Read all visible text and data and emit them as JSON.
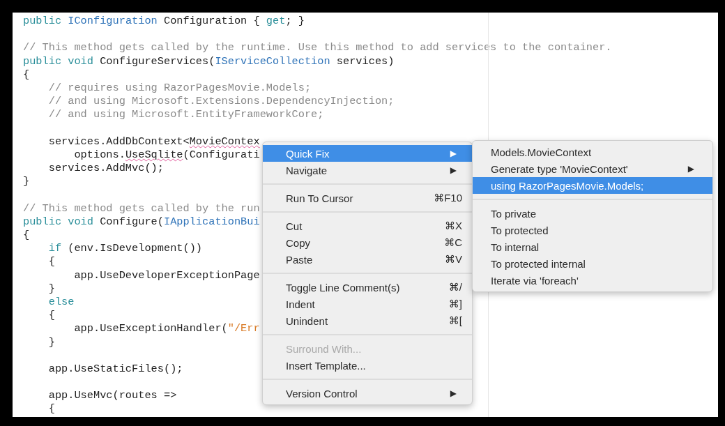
{
  "editor": {
    "lines": [
      {
        "kind": "code",
        "tokens": [
          {
            "text": "public ",
            "kind": "keyword"
          },
          {
            "text": "IConfiguration",
            "kind": "type"
          },
          {
            "text": " Configuration { ",
            "kind": "plain"
          },
          {
            "text": "get",
            "kind": "keyword"
          },
          {
            "text": "; }",
            "kind": "plain"
          }
        ]
      },
      {
        "kind": "blank"
      },
      {
        "kind": "code",
        "tokens": [
          {
            "text": "// This method gets called by the runtime. Use this method to add services to the container.",
            "kind": "comment"
          }
        ]
      },
      {
        "kind": "code",
        "tokens": [
          {
            "text": "public void",
            "kind": "keyword"
          },
          {
            "text": " ConfigureServices(",
            "kind": "plain"
          },
          {
            "text": "IServiceCollection",
            "kind": "type"
          },
          {
            "text": " services)",
            "kind": "plain"
          }
        ]
      },
      {
        "kind": "code",
        "tokens": [
          {
            "text": "{",
            "kind": "plain"
          }
        ]
      },
      {
        "kind": "code",
        "tokens": [
          {
            "text": "    // requires using RazorPagesMovie.Models;",
            "kind": "comment"
          }
        ]
      },
      {
        "kind": "code",
        "tokens": [
          {
            "text": "    // and using Microsoft.Extensions.DependencyInjection;",
            "kind": "comment"
          }
        ]
      },
      {
        "kind": "code",
        "tokens": [
          {
            "text": "    // and using Microsoft.EntityFrameworkCore;",
            "kind": "comment"
          }
        ]
      },
      {
        "kind": "blank"
      },
      {
        "kind": "code",
        "tokens": [
          {
            "text": "    services.AddDbContext<",
            "kind": "plain"
          },
          {
            "text": "MovieContex",
            "kind": "error"
          }
        ]
      },
      {
        "kind": "code",
        "tokens": [
          {
            "text": "        options.",
            "kind": "plain"
          },
          {
            "text": "UseSqlite",
            "kind": "error"
          },
          {
            "text": "(Configurati",
            "kind": "plain"
          }
        ]
      },
      {
        "kind": "code",
        "tokens": [
          {
            "text": "    services.AddMvc();",
            "kind": "plain"
          }
        ]
      },
      {
        "kind": "code",
        "tokens": [
          {
            "text": "}",
            "kind": "plain"
          }
        ]
      },
      {
        "kind": "blank"
      },
      {
        "kind": "code",
        "tokens": [
          {
            "text": "// This method gets called by the run",
            "kind": "comment"
          }
        ]
      },
      {
        "kind": "code",
        "tokens": [
          {
            "text": "public void",
            "kind": "keyword"
          },
          {
            "text": " Configure(",
            "kind": "plain"
          },
          {
            "text": "IApplicationBui",
            "kind": "type"
          }
        ]
      },
      {
        "kind": "code",
        "tokens": [
          {
            "text": "{",
            "kind": "plain"
          }
        ]
      },
      {
        "kind": "code",
        "tokens": [
          {
            "text": "    if",
            "kind": "keyword"
          },
          {
            "text": " (env.IsDevelopment())",
            "kind": "plain"
          }
        ]
      },
      {
        "kind": "code",
        "tokens": [
          {
            "text": "    {",
            "kind": "plain"
          }
        ]
      },
      {
        "kind": "code",
        "tokens": [
          {
            "text": "        app.UseDeveloperExceptionPage",
            "kind": "plain"
          }
        ]
      },
      {
        "kind": "code",
        "tokens": [
          {
            "text": "    }",
            "kind": "plain"
          }
        ]
      },
      {
        "kind": "code",
        "tokens": [
          {
            "text": "    else",
            "kind": "keyword"
          }
        ]
      },
      {
        "kind": "code",
        "tokens": [
          {
            "text": "    {",
            "kind": "plain"
          }
        ]
      },
      {
        "kind": "code",
        "tokens": [
          {
            "text": "        app.UseExceptionHandler(",
            "kind": "plain"
          },
          {
            "text": "\"/Err",
            "kind": "string"
          }
        ]
      },
      {
        "kind": "code",
        "tokens": [
          {
            "text": "    }",
            "kind": "plain"
          }
        ]
      },
      {
        "kind": "blank"
      },
      {
        "kind": "code",
        "tokens": [
          {
            "text": "    app.UseStaticFiles();",
            "kind": "plain"
          }
        ]
      },
      {
        "kind": "blank"
      },
      {
        "kind": "code",
        "tokens": [
          {
            "text": "    app.UseMvc(routes =>",
            "kind": "plain"
          }
        ]
      },
      {
        "kind": "code",
        "tokens": [
          {
            "text": "    {",
            "kind": "plain"
          }
        ]
      }
    ]
  },
  "context_menu": {
    "items": [
      {
        "kind": "item",
        "label": "Quick Fix",
        "arrow": "▶",
        "selected": true,
        "disabled": false
      },
      {
        "kind": "item",
        "label": "Navigate",
        "arrow": "▶",
        "selected": false,
        "disabled": false
      },
      {
        "kind": "separator"
      },
      {
        "kind": "item",
        "label": "Run To Cursor",
        "shortcut": "⌘F10",
        "selected": false,
        "disabled": false
      },
      {
        "kind": "separator"
      },
      {
        "kind": "item",
        "label": "Cut",
        "shortcut": "⌘X",
        "selected": false,
        "disabled": false
      },
      {
        "kind": "item",
        "label": "Copy",
        "shortcut": "⌘C",
        "selected": false,
        "disabled": false
      },
      {
        "kind": "item",
        "label": "Paste",
        "shortcut": "⌘V",
        "selected": false,
        "disabled": false
      },
      {
        "kind": "separator"
      },
      {
        "kind": "item",
        "label": "Toggle Line Comment(s)",
        "shortcut": "⌘/",
        "selected": false,
        "disabled": false
      },
      {
        "kind": "item",
        "label": "Indent",
        "shortcut": "⌘]",
        "selected": false,
        "disabled": false
      },
      {
        "kind": "item",
        "label": "Unindent",
        "shortcut": "⌘[",
        "selected": false,
        "disabled": false
      },
      {
        "kind": "separator"
      },
      {
        "kind": "item",
        "label": "Surround With...",
        "selected": false,
        "disabled": true
      },
      {
        "kind": "item",
        "label": "Insert Template...",
        "selected": false,
        "disabled": false
      },
      {
        "kind": "separator"
      },
      {
        "kind": "item",
        "label": "Version Control",
        "arrow": "▶",
        "selected": false,
        "disabled": false
      }
    ]
  },
  "submenu": {
    "items": [
      {
        "kind": "item",
        "label": "Models.MovieContext",
        "selected": false,
        "disabled": false
      },
      {
        "kind": "item",
        "label": "Generate type 'MovieContext'",
        "arrow": "▶",
        "selected": false,
        "disabled": false
      },
      {
        "kind": "item",
        "label": "using RazorPagesMovie.Models;",
        "selected": true,
        "disabled": false
      },
      {
        "kind": "separator"
      },
      {
        "kind": "item",
        "label": "To private",
        "selected": false,
        "disabled": false
      },
      {
        "kind": "item",
        "label": "To protected",
        "selected": false,
        "disabled": false
      },
      {
        "kind": "item",
        "label": "To internal",
        "selected": false,
        "disabled": false
      },
      {
        "kind": "item",
        "label": "To protected internal",
        "selected": false,
        "disabled": false
      },
      {
        "kind": "item",
        "label": "Iterate via 'foreach'",
        "selected": false,
        "disabled": false
      }
    ]
  }
}
